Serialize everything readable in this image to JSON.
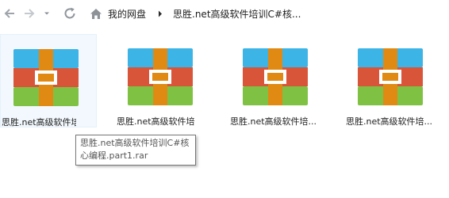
{
  "toolbar": {
    "back_icon": "back-arrow-icon",
    "forward_icon": "forward-arrow-icon",
    "recent_icon": "chevron-down-icon",
    "refresh_icon": "refresh-icon"
  },
  "breadcrumb": {
    "home_icon": "home-icon",
    "items": [
      "我的网盘",
      "思胜.net高级软件培训C#核..."
    ]
  },
  "files": [
    {
      "label": "思胜.net高级软件培",
      "icon": "rar-archive-icon",
      "selected": true
    },
    {
      "label": "思胜.net高级软件培",
      "icon": "rar-archive-icon",
      "selected": false
    },
    {
      "label": "思胜.net高级软件培...",
      "icon": "rar-archive-icon",
      "selected": false
    },
    {
      "label": "思胜.net高级软件培...",
      "icon": "rar-archive-icon",
      "selected": false
    }
  ],
  "tooltip": {
    "line1": "思胜.net高级软件培训C#核",
    "line2": "心编程.part1.rar"
  },
  "colors": {
    "archive_top": "#3cb4e6",
    "archive_middle": "#d9553a",
    "archive_bottom": "#7fc243",
    "archive_band": "#e08a14"
  }
}
